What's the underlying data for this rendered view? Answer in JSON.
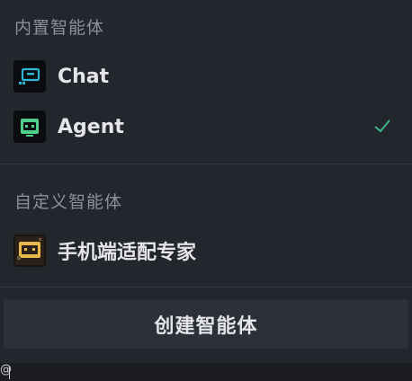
{
  "sections": {
    "builtin_label": "内置智能体",
    "custom_label": "自定义智能体"
  },
  "items": [
    {
      "label": "Chat",
      "icon": "chat-bubble-icon",
      "selected": false
    },
    {
      "label": "Agent",
      "icon": "robot-icon",
      "selected": true
    },
    {
      "label": "手机端适配专家",
      "icon": "custom-agent-icon",
      "selected": false
    }
  ],
  "create_button": {
    "label": "创建智能体"
  },
  "input": {
    "text": "@"
  },
  "colors": {
    "panel_bg": "#24262d",
    "text": "#e4e5e8",
    "muted": "#8d9099",
    "check": "#3fb98a",
    "chat_icon": "#2fb6d8",
    "agent_icon": "#4fd08a",
    "custom_icon": "#e8b84a"
  }
}
